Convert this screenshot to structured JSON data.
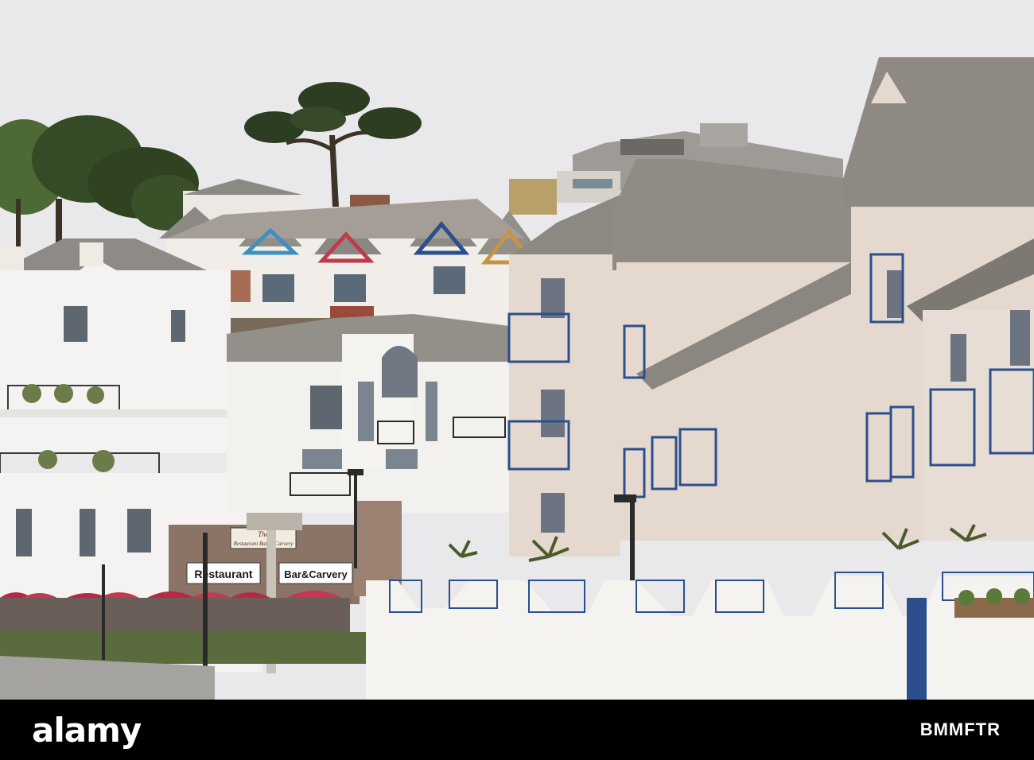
{
  "signs": {
    "restaurant_panel": "Restaurant",
    "bar_carvery_panel": "Bar&Carvery",
    "pub_sign_top": "The",
    "pub_sign_name": "Restaurant Bar & Carvery"
  },
  "watermark": {
    "logo": "alamy",
    "image_id": "BMMFTR"
  },
  "colors": {
    "sky": "#e9e8ea",
    "render_white": "#f3f2f0",
    "render_beige": "#e5d9cf",
    "slate_roof": "#9a9690",
    "balcony_blue": "#2b4f8c",
    "parasol": "#b42a44"
  }
}
